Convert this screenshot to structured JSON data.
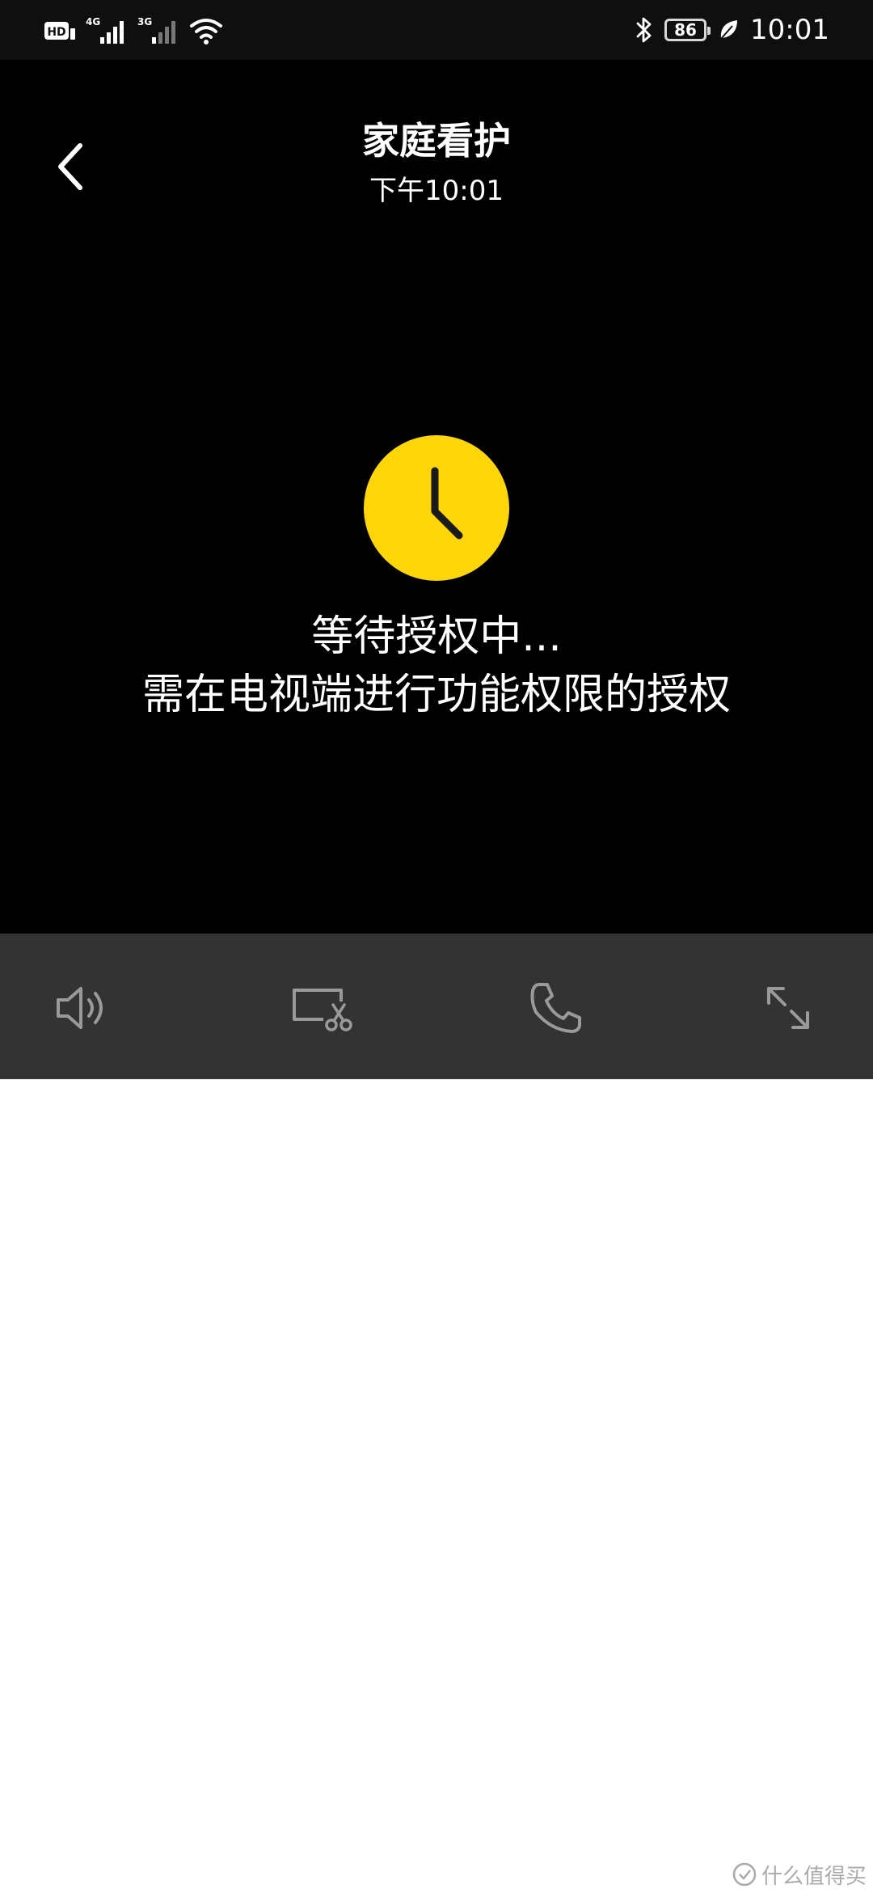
{
  "status_bar": {
    "hd_label": "HD",
    "sim1_label": "4G",
    "sim2_label": "3G",
    "battery": "86",
    "time": "10:01"
  },
  "header": {
    "title": "家庭看护",
    "subtitle": "下午10:01"
  },
  "status": {
    "line1": "等待授权中...",
    "line2": "需在电视端进行功能权限的授权"
  },
  "controls": [
    {
      "icon": "speaker-icon",
      "label": "speaker"
    },
    {
      "icon": "screenshot-icon",
      "label": "screenshot"
    },
    {
      "icon": "phone-icon",
      "label": "call"
    },
    {
      "icon": "expand-icon",
      "label": "fullscreen"
    }
  ],
  "watermark": {
    "text": "什么值得买"
  },
  "colors": {
    "accent_yellow": "#FFD60A",
    "background": "#000000",
    "control_bar": "#333333",
    "control_icon": "#9a9a9a"
  }
}
